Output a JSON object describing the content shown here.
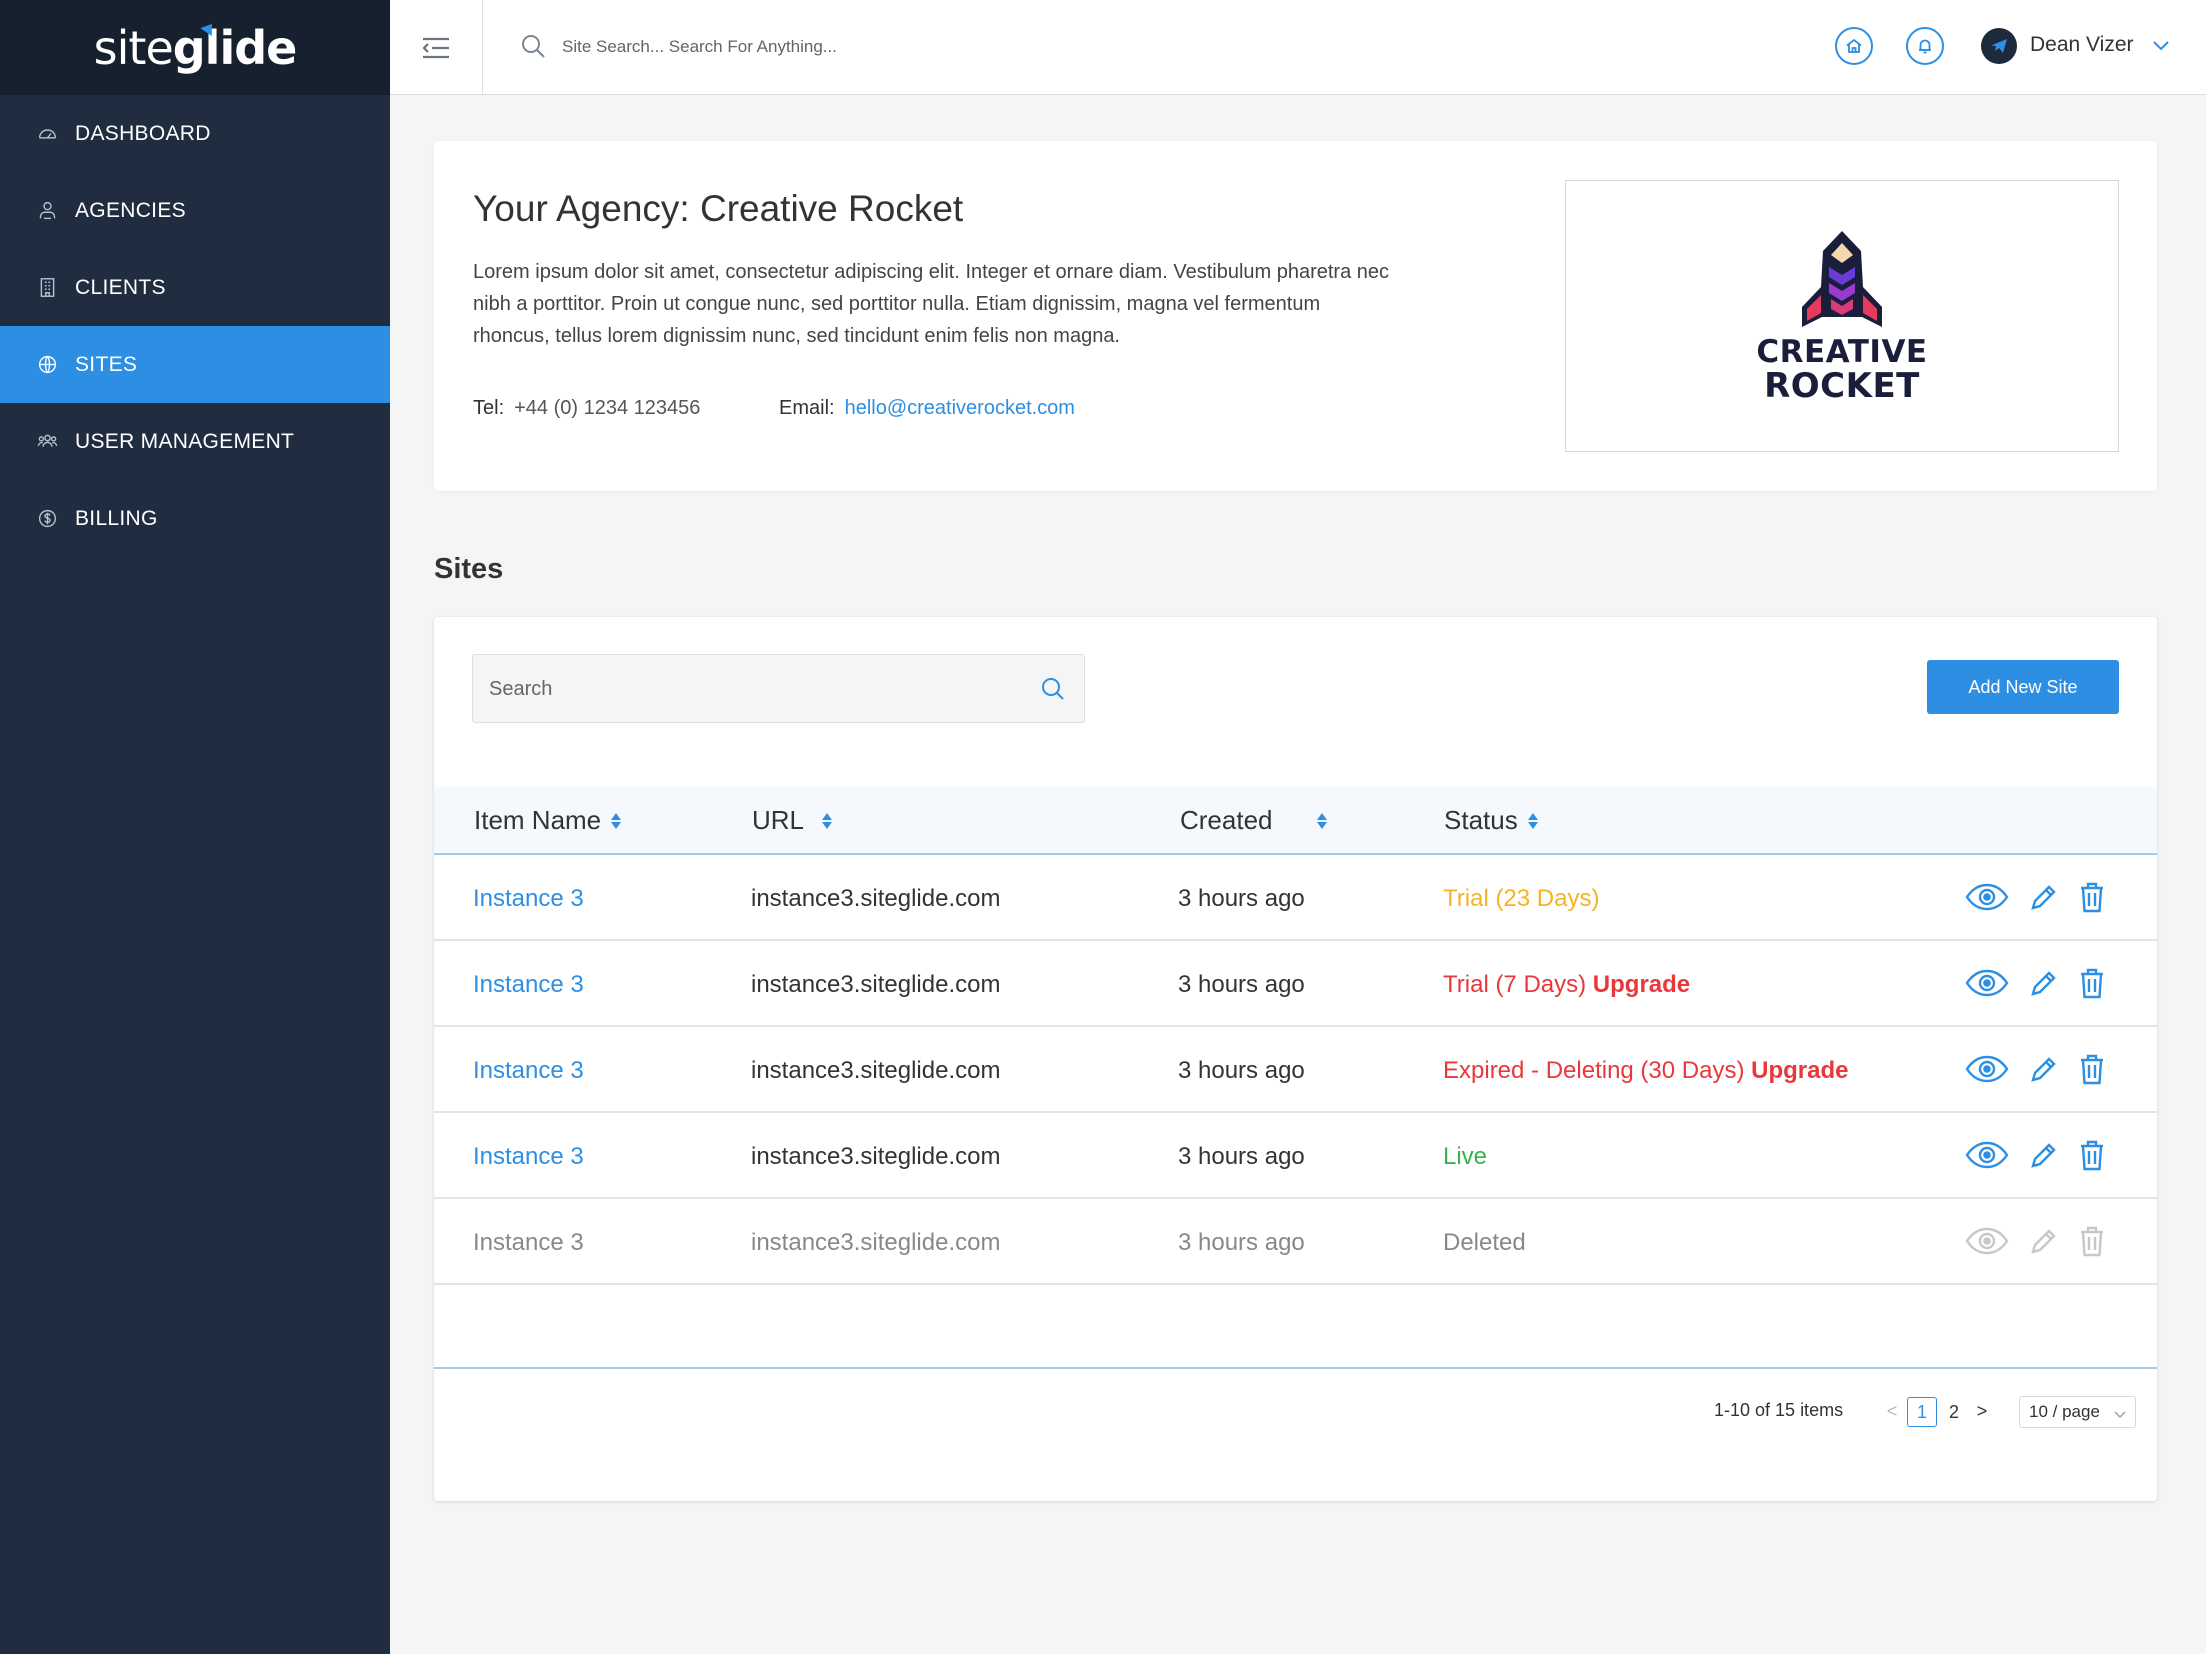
{
  "app": {
    "logo_prefix": "site",
    "logo_suffix": "glide"
  },
  "sidebar": {
    "items": [
      {
        "label": "DASHBOARD",
        "icon": "dashboard-icon"
      },
      {
        "label": "AGENCIES",
        "icon": "agencies-icon"
      },
      {
        "label": "CLIENTS",
        "icon": "building-icon"
      },
      {
        "label": "SITES",
        "icon": "globe-icon",
        "active": true
      },
      {
        "label": "USER MANAGEMENT",
        "icon": "users-icon"
      },
      {
        "label": "BILLING",
        "icon": "dollar-icon"
      }
    ]
  },
  "topbar": {
    "search_placeholder": "Site Search... Search For Anything...",
    "user_name": "Dean Vizer"
  },
  "agency": {
    "title": "Your Agency: Creative Rocket",
    "description": "Lorem ipsum dolor sit amet, consectetur adipiscing elit. Integer et ornare diam. Vestibulum pharetra nec nibh a porttitor. Proin ut congue nunc, sed porttitor nulla. Etiam dignissim, magna vel fermentum rhoncus, tellus lorem dignissim nunc, sed tincidunt enim felis non magna.",
    "tel_label": "Tel:",
    "tel_value": "+44 (0) 1234 123456",
    "email_label": "Email:",
    "email_value": "hello@creativerocket.com",
    "logo_line1": "CREATIVE",
    "logo_line2": "ROCKET"
  },
  "sites": {
    "heading": "Sites",
    "search_placeholder": "Search",
    "add_button": "Add New Site",
    "columns": [
      "Item Name",
      "URL",
      "Created",
      "Status"
    ],
    "rows": [
      {
        "name": "Instance 3",
        "url": "instance3.siteglide.com",
        "created": "3 hours ago",
        "status": "Trial (23 Days)",
        "upgrade": "",
        "status_type": "trial-long"
      },
      {
        "name": "Instance 3",
        "url": "instance3.siteglide.com",
        "created": "3 hours ago",
        "status": "Trial (7 Days)",
        "upgrade": "Upgrade",
        "status_type": "trial-short"
      },
      {
        "name": "Instance 3",
        "url": "instance3.siteglide.com",
        "created": "3 hours ago",
        "status": "Expired - Deleting (30 Days)",
        "upgrade": "Upgrade",
        "status_type": "expired"
      },
      {
        "name": "Instance 3",
        "url": "instance3.siteglide.com",
        "created": "3 hours ago",
        "status": "Live",
        "upgrade": "",
        "status_type": "live"
      },
      {
        "name": "Instance 3",
        "url": "instance3.siteglide.com",
        "created": "3 hours ago",
        "status": "Deleted",
        "upgrade": "",
        "status_type": "deleted"
      }
    ],
    "pagination": {
      "summary": "1-10 of 15 items",
      "prev": "<",
      "pages": [
        "1",
        "2"
      ],
      "current_page": "1",
      "next": ">",
      "page_size": "10 / page"
    }
  },
  "colors": {
    "accent": "#2d8fe3",
    "sidebar_bg": "#202c3f",
    "trial": "#f5b325",
    "danger": "#e8383b",
    "live": "#36b54a"
  }
}
